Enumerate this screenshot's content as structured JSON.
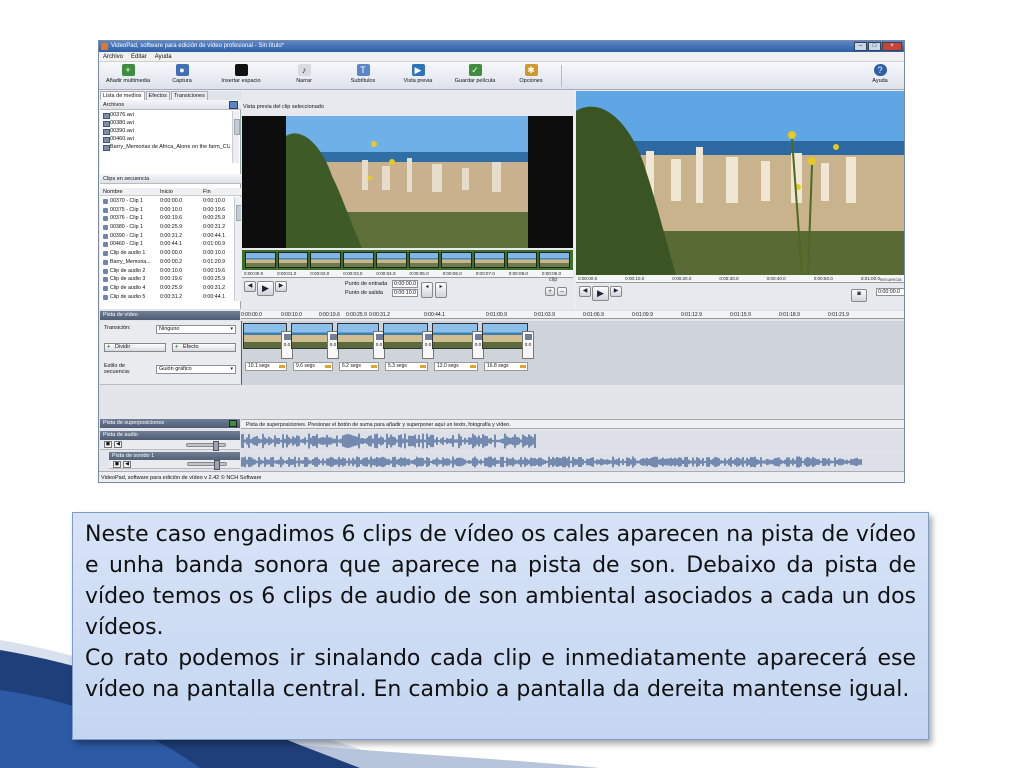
{
  "window": {
    "title": "VideoPad, software para edición de vídeo profesional - Sin título*",
    "controls": [
      "–",
      "□",
      "×"
    ]
  },
  "menu": [
    "Archivo",
    "Editar",
    "Ayuda"
  ],
  "toolbar": {
    "add_media": "Añadir multimedia",
    "capture": "Captura",
    "insert_space": "Insertar espacio",
    "narrate": "Narrar",
    "subtitles": "Subtítulos",
    "preview": "Vista previa",
    "save_movie": "Guardar película",
    "options": "Opciones",
    "help": "Ayuda"
  },
  "media_panel": {
    "tabs": [
      "Lista de medios",
      "Efectos",
      "Transiciones"
    ],
    "files_header": "Archivos",
    "files": [
      "00376.avi",
      "00380.avi",
      "00390.avi",
      "00460.avi",
      "Barry_Memorias de Africa_Alone on the farm_CU"
    ],
    "clips_header": "Clips en secuencia",
    "columns": {
      "name": "Nombre",
      "start": "Inicio",
      "end": "Fin"
    },
    "clips": [
      {
        "name": "00370 - Clip 1",
        "start": "0:00:00.0",
        "end": "0:00:10.0"
      },
      {
        "name": "00375 - Clip 1",
        "start": "0:00:10.0",
        "end": "0:00:19.6"
      },
      {
        "name": "00376 - Clip 1",
        "start": "0:00:19.6",
        "end": "0:00:25.9"
      },
      {
        "name": "00380 - Clip 1",
        "start": "0:00:25.9",
        "end": "0:00:31.2"
      },
      {
        "name": "00390 - Clip 1",
        "start": "0:00:31.2",
        "end": "0:00:44.1"
      },
      {
        "name": "00460 - Clip 1",
        "start": "0:00:44.1",
        "end": "0:01:00.9"
      },
      {
        "name": "Clip de audio 1",
        "start": "0:00:00.0",
        "end": "0:00:10.0"
      },
      {
        "name": "Barry_Memoria...",
        "start": "0:00:00.2",
        "end": "0:01:20.9"
      },
      {
        "name": "Clip de audio 2",
        "start": "0:00:10.0",
        "end": "0:00:19.6"
      },
      {
        "name": "Clip de audio 3",
        "start": "0:00:19.6",
        "end": "0:00:25.9"
      },
      {
        "name": "Clip de audio 4",
        "start": "0:00:25.9",
        "end": "0:00:31.2"
      },
      {
        "name": "Clip de audio 5",
        "start": "0:00:31.2",
        "end": "0:00:44.1"
      }
    ]
  },
  "clip_preview": {
    "header": "Vista previa del clip seleccionado",
    "ruler": [
      "0:00:00.0",
      "0:00:01.0",
      "0:00:02.0",
      "0:00:03.0",
      "0:00:04.0",
      "0:00:05.0",
      "0:00:06.0",
      "0:00:07.0",
      "0:00:08.0",
      "0:00:09.0"
    ],
    "in_label": "Punto de entrada",
    "in_value": "0:00:00.0",
    "out_label": "Punto de salida",
    "out_value": "0:00:10.0",
    "tab": "clip"
  },
  "sequence_preview": {
    "ruler": [
      "0:00:00.0",
      "0:00:10.0",
      "0:00:20.0",
      "0:00:30.0",
      "0:00:40.0",
      "0:00:50.0",
      "0:01:00.0"
    ],
    "tab": "secuencia",
    "time": "0:00:00.0"
  },
  "timeline": {
    "ruler": [
      "0:00:00.0",
      "0:00:10.0",
      "0:00:19.6",
      "0:00:25.9",
      "0:00:31.2",
      "0:00:44.1",
      "0:01:00.9",
      "0:01:03.9",
      "0:01:06.9",
      "0:01:09.9",
      "0:01:12.9",
      "0:01:15.9",
      "0:01:18.9",
      "0:01:21.9"
    ],
    "video_track": "Pista de vídeo",
    "transition_label": "Transición:",
    "transition_value": "Ninguno",
    "split_button": "Dividir",
    "effect_button": "Efecto",
    "seq_style_label": "Estilo de secuencia:",
    "seq_style_value": "Guión gráfico",
    "transition_values": [
      "0.0",
      "0.0",
      "0.0",
      "0.0",
      "0.0",
      "0.0"
    ],
    "durations": [
      "10.1 segs",
      "9.6 segs",
      "6.2 segs",
      "5.3 segs",
      "13.0 segs",
      "16.8 segs"
    ],
    "overlay_track": "Pista de superposiciones",
    "overlay_hint": "Pista de superposiciones. Presionar el botón de suma para añadir y superponer aquí un texto, fotografía y vídeo.",
    "audio_track": "Pista de audio",
    "sound_track_1": "Pista de sonido 1",
    "sound_track_2": "Pista de sonido 2"
  },
  "statusbar": "VideoPad, software para edición de vídeo v 2.42 © NCH Software",
  "caption": {
    "paragraph1": "Neste caso engadimos 6 clips de vídeo os cales aparecen na pista de vídeo e unha banda sonora que aparece na pista de son. Debaixo da pista de vídeo temos os 6 clips de audio de son ambiental asociados a cada un dos vídeos.",
    "paragraph2": "Co rato podemos ir sinalando cada clip e inmediatamente aparecerá ese vídeo na pantalla central. En cambio a pantalla da dereita mantense igual."
  },
  "colors": {
    "caption_bg": "#cddcf4",
    "title_bar": "#3f6fb5",
    "swoosh_dark": "#1f3f7a",
    "swoosh_light": "#c7d3e8"
  }
}
